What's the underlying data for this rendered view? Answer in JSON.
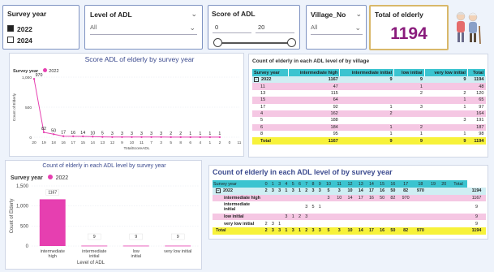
{
  "slicers": {
    "survey_year": {
      "title": "Survey year",
      "options": [
        {
          "label": "2022",
          "checked": true
        },
        {
          "label": "2024",
          "checked": false
        }
      ]
    },
    "level_adl": {
      "title": "Level of ADL",
      "value": "All"
    },
    "score_adl": {
      "title": "Score of ADL",
      "min": "0",
      "max": "20"
    },
    "village": {
      "title": "Village_No",
      "value": "All"
    }
  },
  "kpi": {
    "title": "Total of elderly",
    "value": "1194"
  },
  "chart_score": {
    "title": "Score ADL of elderly by survey year",
    "legend_title": "Survey year",
    "legend_item": "2022",
    "accent": "#e63fb0"
  },
  "chart_data": [
    {
      "type": "line",
      "title": "Score ADL of elderly by survey year",
      "xlabel": "TotalScoreADL",
      "ylabel": "Count of Elderly",
      "x": [
        "20",
        "19",
        "18",
        "16",
        "17",
        "15",
        "14",
        "13",
        "12",
        "9",
        "10",
        "11",
        "7",
        "3",
        "5",
        "8",
        "6",
        "4",
        "1",
        "2",
        "0",
        "11"
      ],
      "series": [
        {
          "name": "2022",
          "values": [
            970,
            82,
            50,
            17,
            16,
            14,
            10,
            5,
            3,
            3,
            3,
            3,
            3,
            3,
            2,
            2,
            1,
            1,
            1,
            1,
            null,
            null
          ]
        }
      ],
      "yticks": [
        "1,000",
        "500",
        "0"
      ],
      "ylim": [
        0,
        1000
      ]
    },
    {
      "type": "bar",
      "title": "Count of elderly in each ADL level by survey year",
      "xlabel": "Level of ADL",
      "ylabel": "Count of Elderly",
      "categories": [
        "intermediate high",
        "intermediate initial",
        "low initial",
        "very low initial"
      ],
      "series": [
        {
          "name": "2022",
          "values": [
            1167,
            9,
            9,
            9
          ]
        }
      ],
      "yticks": [
        "1,500",
        "1,000",
        "500",
        "0"
      ],
      "ylim": [
        0,
        1500
      ]
    }
  ],
  "bar_panel": {
    "legend_title": "Survey year",
    "legend_item": "2022"
  },
  "village_table": {
    "title": "Count of elderly in each ADL level of by village",
    "headers": [
      "Survey year",
      "intermediate high",
      "intermediate initial",
      "low initial",
      "very low initial",
      "Total"
    ],
    "group_label": "2022",
    "group_row": [
      "1167",
      "9",
      "9",
      "9",
      "1194"
    ],
    "rows": [
      [
        "11",
        "47",
        "",
        "1",
        "",
        "48"
      ],
      [
        "13",
        "115",
        "",
        "2",
        "2",
        "1",
        "120"
      ],
      [
        "15",
        "64",
        "",
        "",
        "1",
        "65"
      ],
      [
        "17",
        "92",
        "1",
        "3",
        "1",
        "97"
      ],
      [
        "4",
        "162",
        "2",
        "",
        "",
        "164"
      ],
      [
        "5",
        "188",
        "",
        "",
        "3",
        "191"
      ],
      [
        "6",
        "184",
        "1",
        "2",
        "",
        "187"
      ],
      [
        "8",
        "95",
        "1",
        "1",
        "1",
        "98"
      ]
    ],
    "total_row": [
      "Total",
      "1167",
      "9",
      "9",
      "9",
      "1194"
    ]
  },
  "score_table": {
    "title": "Count of elderly in each ADL level of by survey year",
    "headers": [
      "Survey year",
      "0",
      "1",
      "3",
      "4",
      "5",
      "6",
      "7",
      "8",
      "9",
      "10",
      "11",
      "12",
      "13",
      "14",
      "15",
      "16",
      "17",
      "18",
      "19",
      "20",
      "Total"
    ],
    "rows": [
      {
        "label": "2022",
        "sub": false,
        "cells": [
          "2",
          "3",
          "3",
          "1",
          "3",
          "1",
          "2",
          "3",
          "3",
          "5",
          "3",
          "10",
          "14",
          "17",
          "16",
          "50",
          "82",
          "970",
          "",
          "",
          "",
          "1194"
        ]
      },
      {
        "label": "intermediate high",
        "sub": true,
        "cells": [
          "",
          "",
          "",
          "",
          "",
          "",
          "",
          "",
          "",
          "3",
          "10",
          "14",
          "17",
          "16",
          "50",
          "82",
          "970",
          "",
          "",
          "",
          "",
          "1167"
        ]
      },
      {
        "label": "intermediate initial",
        "sub": true,
        "cells": [
          "",
          "",
          "",
          "",
          "",
          "",
          "3",
          "5",
          "1",
          "",
          "",
          "",
          "",
          "",
          "",
          "",
          "",
          "",
          "",
          "",
          "",
          "9"
        ]
      },
      {
        "label": "low initial",
        "sub": true,
        "cells": [
          "",
          "",
          "",
          "3",
          "1",
          "2",
          "3",
          "",
          "",
          "",
          "",
          "",
          "",
          "",
          "",
          "",
          "",
          "",
          "",
          "",
          "",
          "9"
        ]
      },
      {
        "label": "very low initial",
        "sub": true,
        "cells": [
          "2",
          "3",
          "1",
          "",
          "",
          "",
          "",
          "",
          "",
          "",
          "",
          "",
          "",
          "",
          "",
          "",
          "",
          "",
          "",
          "",
          "",
          "9"
        ]
      },
      {
        "label": "Total",
        "sub": false,
        "cells": [
          "2",
          "3",
          "3",
          "1",
          "3",
          "1",
          "2",
          "3",
          "3",
          "5",
          "3",
          "10",
          "14",
          "17",
          "16",
          "50",
          "82",
          "970",
          "",
          "",
          "",
          "1194"
        ]
      }
    ]
  }
}
